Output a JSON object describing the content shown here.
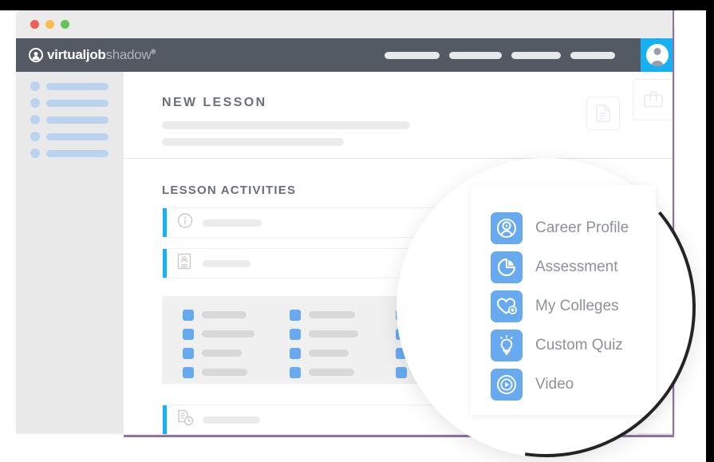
{
  "browser": {
    "window_dots": [
      {
        "name": "close-dot",
        "color": "#ef5f56"
      },
      {
        "name": "minimize-dot",
        "color": "#f6bd4f"
      },
      {
        "name": "maximize-dot",
        "color": "#61c454"
      }
    ]
  },
  "navbar": {
    "logo": {
      "bold_text": "virtualjob",
      "light_text": "shadow",
      "registered_mark": "®",
      "icon": "person-circle-logo-icon"
    },
    "nav_items": [
      {
        "name": "nav-placeholder-1",
        "label": ""
      },
      {
        "name": "nav-placeholder-2",
        "label": ""
      },
      {
        "name": "nav-placeholder-3",
        "label": ""
      },
      {
        "name": "nav-placeholder-4",
        "label": ""
      }
    ],
    "avatar": {
      "icon": "user-avatar-icon",
      "accent_color": "#16b1f2"
    }
  },
  "sidebar": {
    "items": [
      {
        "name": "sidebar-item-1",
        "label": ""
      },
      {
        "name": "sidebar-item-2",
        "label": ""
      },
      {
        "name": "sidebar-item-3",
        "label": ""
      },
      {
        "name": "sidebar-item-4",
        "label": ""
      },
      {
        "name": "sidebar-item-5",
        "label": ""
      }
    ]
  },
  "main": {
    "page_title": "NEW LESSON",
    "header_actions": [
      {
        "name": "document-action",
        "icon": "document-icon"
      },
      {
        "name": "briefcase-action",
        "icon": "briefcase-icon"
      }
    ],
    "section_title": "LESSON ACTIVITIES",
    "activities": [
      {
        "name": "activity-row-info",
        "icon": "info-circle-icon",
        "label": ""
      },
      {
        "name": "activity-row-profile",
        "icon": "id-card-icon",
        "label": ""
      },
      {
        "name": "activity-row-report",
        "icon": "document-clock-icon",
        "label": ""
      }
    ],
    "checkbox_grid": {
      "columns": 3,
      "rows": 4,
      "checkbox_color": "#67aaf0"
    }
  },
  "magnifier": {
    "menu_items": [
      {
        "label": "Career Profile",
        "icon": "career-profile-icon"
      },
      {
        "label": "Assessment",
        "icon": "pie-chart-icon"
      },
      {
        "label": "My Colleges",
        "icon": "heart-plus-icon"
      },
      {
        "label": "Custom Quiz",
        "icon": "lightbulb-icon"
      },
      {
        "label": "Video",
        "icon": "play-circle-icon"
      }
    ],
    "icon_color": "#67aaf0",
    "label_color": "#8d9298"
  },
  "accents": {
    "blue": "#16b1f2",
    "purple": "#8d72a8",
    "navbar_gray": "#545a64"
  }
}
